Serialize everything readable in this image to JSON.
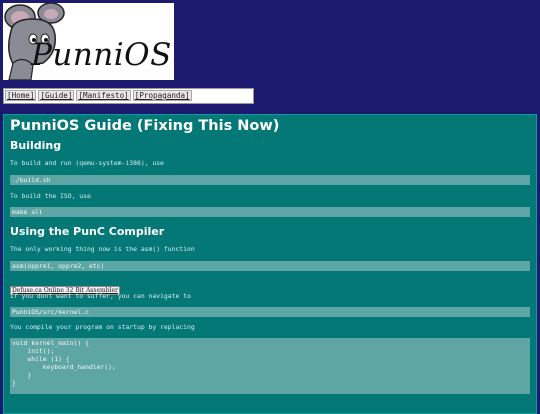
{
  "logo": {
    "text": "PunniOS",
    "mascot": "mouse-mascot-icon"
  },
  "nav": {
    "items": [
      "[Home]",
      "[Guide]",
      "[Manifesto]",
      "[Propaganda]"
    ]
  },
  "guide": {
    "title": "PunniOS Guide (Fixing This Now)",
    "building": {
      "heading": "Building",
      "run_text": "To build and run (qemu-system-i386), use",
      "run_cmd": "./build.sh",
      "iso_text": "To build the ISO, use",
      "iso_cmd": "make all"
    },
    "punc": {
      "heading": "Using the PunC Compiler",
      "asm_text": "The only working thing now is the asm() function",
      "asm_code": "asm(oppre1, oppre2, etc)",
      "link_label": "Defuse.ca Online 32 Bit Assembler",
      "navigate_text": "If you dont want to suffer, you can navigate to",
      "kernel_path": "PunniOS/src/kernel.c",
      "compile_text": "You compile your program on startup by replacing",
      "kernel_code": "void kernel_main() {\n    init();\n    while (1) {\n        keyboard_handler();\n    }\n}"
    }
  },
  "colors": {
    "background": "#1b1a6e",
    "content_bg": "#047877",
    "code_bg": "#5ea6a4"
  }
}
